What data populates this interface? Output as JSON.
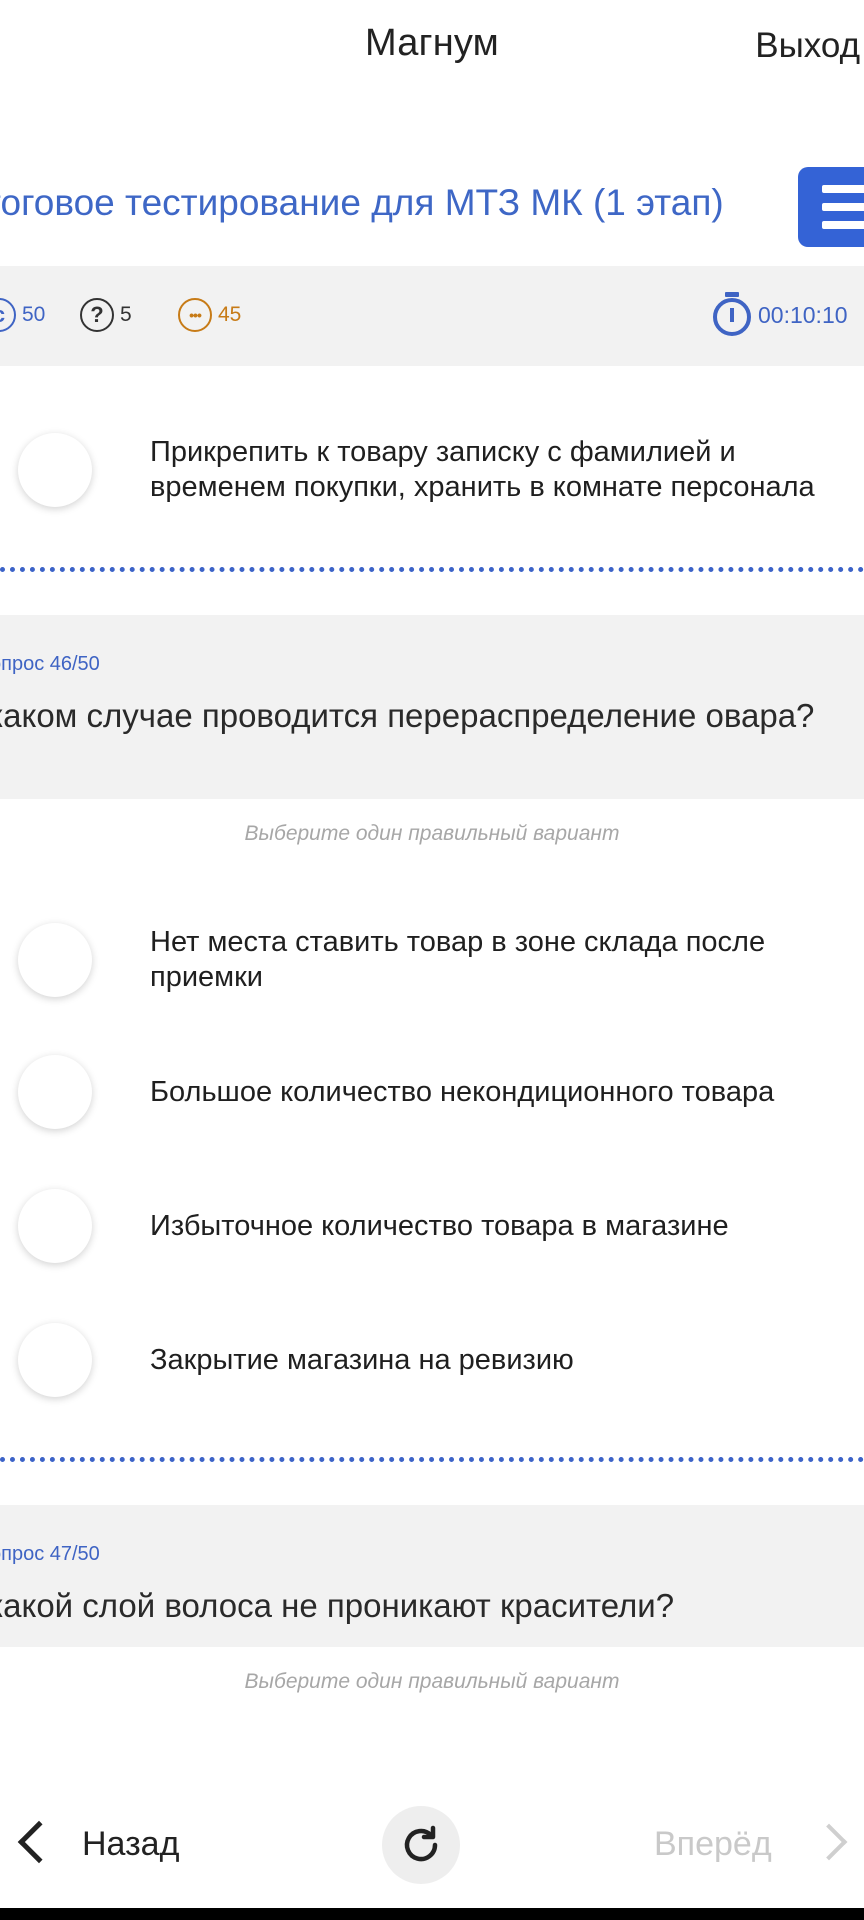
{
  "header": {
    "app_title": "Магнум",
    "logout_label": "Выход"
  },
  "test": {
    "title": "тоговое тестирование для МТЗ МК (1 этап)"
  },
  "stats": {
    "total": "50",
    "unanswered": "5",
    "remaining": "45",
    "timer": "00:10:10",
    "colors": {
      "total": "#3f64c4",
      "remaining": "#c77b17",
      "unanswered": "#333333"
    }
  },
  "prev_question": {
    "last_option": "Прикрепить к товару записку с фамилией и временем покупки, хранить в комнате персонала"
  },
  "question46": {
    "number": "опрос 46/50",
    "text": " каком случае проводится перераспределение овара?",
    "hint": "Выберите один правильный вариант",
    "options": [
      "Нет места ставить товар в зоне склада после приемки",
      "Большое количество некондиционного товара",
      "Избыточное количество товара в магазине",
      "Закрытие магазина на ревизию"
    ]
  },
  "question47": {
    "number": "опрос 47/50",
    "text": " какой слой волоса не проникают красители?",
    "hint": "Выберите один правильный вариант"
  },
  "nav": {
    "back_label": "Назад",
    "next_label": "Вперёд"
  },
  "accent_color": "#3463d6"
}
